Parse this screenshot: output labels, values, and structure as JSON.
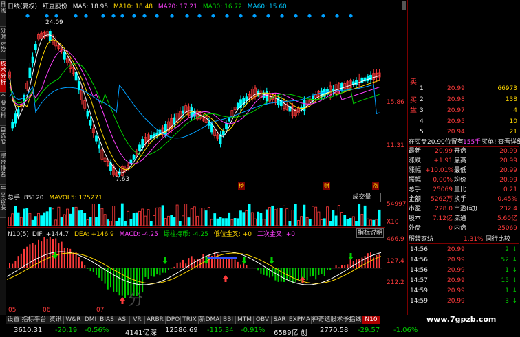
{
  "left_tabs": [
    {
      "label": "日线",
      "active": false
    },
    {
      "label": "分时走势",
      "active": false
    },
    {
      "label": "技术分析",
      "active": true
    },
    {
      "label": "个股资料",
      "active": false
    },
    {
      "label": "自选股",
      "active": false
    },
    {
      "label": "综合排名",
      "active": false
    },
    {
      "label": "牛叉诊股",
      "active": false
    }
  ],
  "header": {
    "period": "日线(复权)",
    "stock": "红豆股份",
    "ma5": "MA5: 18.95",
    "ma10": "MA10: 18.48",
    "ma20": "MA20: 17.21",
    "ma30": "MA30: 16.72",
    "ma60": "MA60: 15.60"
  },
  "colors": {
    "ma5": "#ffffff",
    "ma10": "#ffd700",
    "ma20": "#ff40ff",
    "ma30": "#00d000",
    "ma60": "#00a0ff",
    "up": "#ff3b3b",
    "down": "#00ffff",
    "accent": "#b00000"
  },
  "price_axis": {
    "labels": [
      "15.86",
      "11.31"
    ],
    "high_label": "24.09",
    "low_label": "7.63"
  },
  "event_markers": [
    "榜",
    "财",
    "涨"
  ],
  "volume": {
    "title": "总手: 85120",
    "mavol": "MAVOL5: 175271",
    "button": "成交量",
    "axis": [
      "54997",
      "X10"
    ]
  },
  "macd": {
    "title": "N10(5)",
    "dif": "DIF: +144.7",
    "dea": "DEA: +146.9",
    "macd": "MACD: -4.25",
    "hold": "绿柱持币: -4.25",
    "low_cross": "低位金叉: +0",
    "double_cross": "二次金叉: +0",
    "button": "指标说明",
    "axis": [
      "466.9",
      "127.4",
      "212.2"
    ]
  },
  "months": [
    "05",
    "06",
    "07"
  ],
  "watermark": "分",
  "right_panel": {
    "top_label": "卖",
    "asks_header": "1",
    "bids_label": "买盘",
    "orderbook": [
      {
        "level": "1",
        "price": "20.99",
        "vol": "66973"
      },
      {
        "level": "2",
        "price": "20.98",
        "vol": "138"
      },
      {
        "level": "3",
        "price": "20.97",
        "vol": "4"
      },
      {
        "level": "4",
        "price": "20.95",
        "vol": "10"
      },
      {
        "level": "5",
        "price": "20.94",
        "vol": "21"
      }
    ],
    "bid_note": "在买盘20.90位置有",
    "bid_vol": "155手",
    "bid_link": "买单!",
    "bid_detail": "查看详细",
    "quote": [
      {
        "k1": "最新",
        "v1": "20.99",
        "k2": "开盘",
        "v2": "20.99"
      },
      {
        "k1": "涨跌",
        "v1": "+1.91",
        "k2": "最高",
        "v2": "20.99"
      },
      {
        "k1": "涨幅",
        "v1": "+10.01%",
        "k2": "最低",
        "v2": "20.99"
      },
      {
        "k1": "振幅",
        "v1": "0.00%",
        "k2": "均价",
        "v2": "20.99"
      },
      {
        "k1": "总手",
        "v1": "25069",
        "k2": "量比",
        "v2": "0.21"
      },
      {
        "k1": "金额",
        "v1": "5262万",
        "k2": "换手",
        "v2": "0.45%"
      },
      {
        "k1": "市盈",
        "v1": "228.0",
        "k2": "市盈(动)",
        "v2": "232.4"
      },
      {
        "k1": "股本",
        "v1": "7.12亿",
        "k2": "流通",
        "v2": "5.60亿"
      },
      {
        "k1": "外盘",
        "v1": "0",
        "k2": "内盘",
        "v2": "25069"
      }
    ],
    "tabs": [
      "服装家纺",
      "1.31%",
      "同行比较"
    ],
    "ticks": [
      {
        "time": "14:56",
        "price": "20.99",
        "vol": "2"
      },
      {
        "time": "14:56",
        "price": "20.99",
        "vol": "52"
      },
      {
        "time": "14:56",
        "price": "20.99",
        "vol": "1"
      },
      {
        "time": "14:57",
        "price": "20.99",
        "vol": "15"
      },
      {
        "time": "14:59",
        "price": "20.99",
        "vol": "1"
      },
      {
        "time": "14:59",
        "price": "20.99",
        "vol": "3"
      }
    ]
  },
  "bottom_tabs": [
    "设置",
    "指标平台",
    "资讯",
    "W&R",
    "DMI",
    "BIAS",
    "ASI",
    "VR",
    "ARBR",
    "DPO",
    "TRIX",
    "新DMA",
    "BBI",
    "MTM",
    "OBV",
    "SAR",
    "EXPMA",
    "神奇选股术予指线",
    "N10"
  ],
  "site": "www.7gpzb.com",
  "status": {
    "sh_index": "3610.31",
    "sh_chg": "-20.19",
    "sh_pct": "-0.56%",
    "sh_amt": "4141亿",
    "sz_name": "深",
    "sz_index": "12586.69",
    "sz_chg": "-115.34",
    "sz_pct": "-0.91%",
    "sz_amt": "6589亿",
    "cy_name": "创",
    "cy_index": "2770.58",
    "cy_chg": "-29.57",
    "cy_pct": "-1.06%"
  }
}
